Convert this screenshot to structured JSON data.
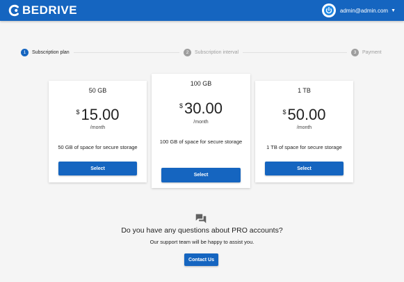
{
  "header": {
    "logo_text": "BEDRIVE",
    "account_email": "admin@admin.com",
    "brand_color": "#1565c0",
    "icons": [
      "logo-icon",
      "power-avatar-icon",
      "caret-down-icon"
    ]
  },
  "stepper": {
    "steps": [
      {
        "number": "1",
        "label": "Subscription plan",
        "active": true
      },
      {
        "number": "2",
        "label": "Subscription interval",
        "active": false
      },
      {
        "number": "3",
        "label": "Payment",
        "active": false
      }
    ]
  },
  "plans": [
    {
      "name": "50 GB",
      "currency": "$",
      "amount": "15.00",
      "period": "/month",
      "description": "50 GB of space for secure storage",
      "button": "Select"
    },
    {
      "name": "100 GB",
      "currency": "$",
      "amount": "30.00",
      "period": "/month",
      "description": "100 GB of space for secure storage",
      "button": "Select"
    },
    {
      "name": "1 TB",
      "currency": "$",
      "amount": "50.00",
      "period": "/month",
      "description": "1 TB of space for secure storage",
      "button": "Select"
    }
  ],
  "support": {
    "icon": "chat-bubbles-icon",
    "title": "Do you have any questions about PRO accounts?",
    "subtitle": "Our support team will be happy to assist you.",
    "button": "Contact Us"
  }
}
